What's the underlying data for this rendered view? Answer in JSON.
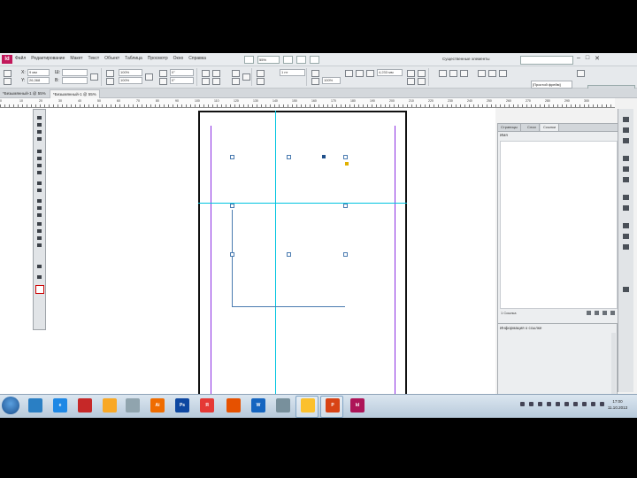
{
  "app": {
    "logo": "Id"
  },
  "menubar": {
    "items": [
      "Файл",
      "Редактирование",
      "Макет",
      "Текст",
      "Объект",
      "Таблица",
      "Просмотр",
      "Окно",
      "Справка"
    ],
    "zoom": "55%",
    "workspace": "Существенные элементы",
    "search_placeholder": "",
    "window_controls": [
      "–",
      "□",
      "✕"
    ]
  },
  "controlbar": {
    "x_label": "X:",
    "y_label": "Y:",
    "x_value": "9 мм",
    "y_value": "26,368",
    "w_label": "Ш:",
    "h_label": "В:",
    "w_value": "",
    "h_value": "",
    "percent_1": "100%",
    "percent_2": "100%",
    "angle_1": "0°",
    "angle_2": "0°",
    "stroke_weight": "1 пт",
    "opacity": "100%",
    "offset": "4,233 мм",
    "style": "[Простой фрейм]",
    "swatch": "[Нет]"
  },
  "tabs": [
    {
      "label": "*Безымянный-1 @ 55%"
    },
    {
      "label": "*Безымянный-1 @ 55%"
    }
  ],
  "ruler": {
    "labels": [
      "0",
      "10",
      "20",
      "30",
      "40",
      "50",
      "60",
      "70",
      "80",
      "90",
      "100",
      "110",
      "120",
      "130",
      "140",
      "150",
      "160",
      "170",
      "180",
      "190",
      "200",
      "210",
      "220",
      "230",
      "240",
      "250",
      "260",
      "270",
      "280",
      "290",
      "300"
    ]
  },
  "panels": {
    "tabs": [
      "Страницы",
      "Слои",
      "Ссылки"
    ],
    "heading": "Имя",
    "status": "1 Ссылка",
    "info_title": "Информация о ссылке"
  },
  "taskbar": {
    "apps": [
      {
        "name": "explorer",
        "label": "",
        "color": "#2a7fc4"
      },
      {
        "name": "ie",
        "label": "e",
        "color": "#1e88e5"
      },
      {
        "name": "app-red",
        "label": "",
        "color": "#c62828"
      },
      {
        "name": "media",
        "label": "",
        "color": "#f9a825"
      },
      {
        "name": "volume",
        "label": "",
        "color": "#90a4ae"
      },
      {
        "name": "illustrator",
        "label": "Ai",
        "color": "#ef6c00"
      },
      {
        "name": "photoshop",
        "label": "Ps",
        "color": "#0d47a1"
      },
      {
        "name": "yandex",
        "label": "Я",
        "color": "#e53935"
      },
      {
        "name": "firefox",
        "label": "",
        "color": "#e65100"
      },
      {
        "name": "word",
        "label": "W",
        "color": "#1565c0"
      },
      {
        "name": "tool",
        "label": "",
        "color": "#78909c"
      },
      {
        "name": "folder",
        "label": "",
        "color": "#fbc02d"
      },
      {
        "name": "powerpoint",
        "label": "P",
        "color": "#d84315"
      },
      {
        "name": "indesign",
        "label": "Id",
        "color": "#ad1457"
      }
    ],
    "time": "17:00",
    "date": "11.10.2013"
  },
  "colors": {
    "margin_guide": "#8a2be2",
    "ruler_guide": "#00c4e0",
    "frame": "#4a7bb0"
  }
}
